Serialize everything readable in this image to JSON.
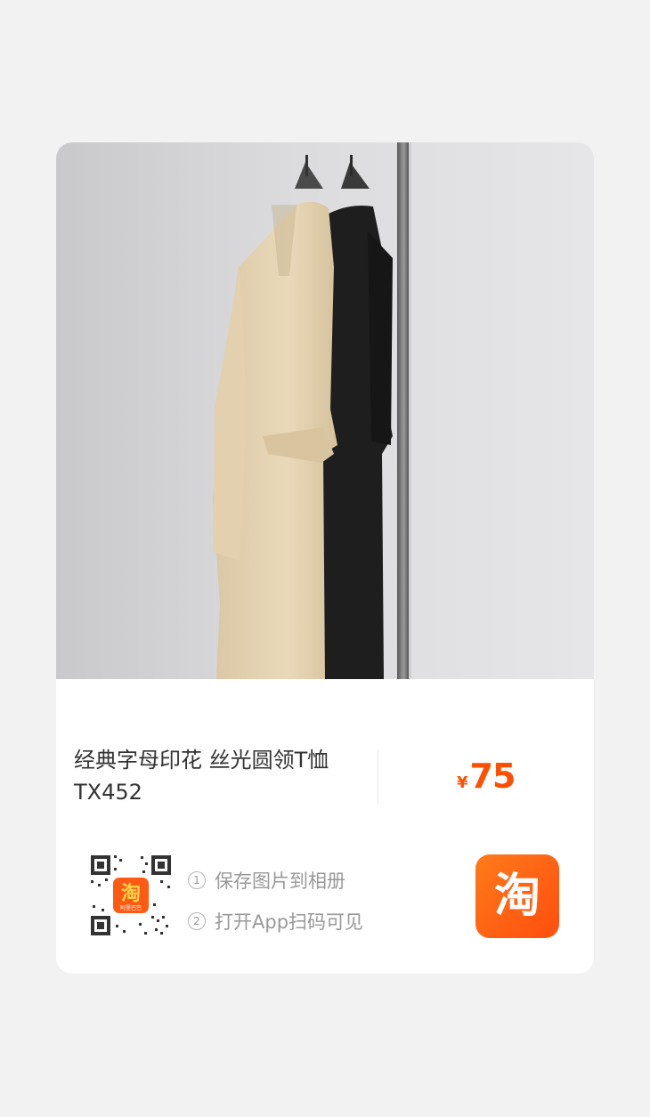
{
  "product": {
    "title_line1": "经典字母印花 丝光圆领T恤",
    "title_line2": "TX452",
    "currency_symbol": "¥",
    "price": "75"
  },
  "instructions": {
    "step1_num": "1",
    "step1": "保存图片到相册",
    "step2_num": "2",
    "step2": "打开App扫码可见"
  },
  "qr_code": {
    "center_logo_char": "淘",
    "center_logo_caption": "阿里巴巴"
  },
  "app_logo": {
    "char": "淘"
  },
  "colors": {
    "price": "#ff5000",
    "logo": "#ff5a14",
    "background": "#f2f2f2"
  }
}
